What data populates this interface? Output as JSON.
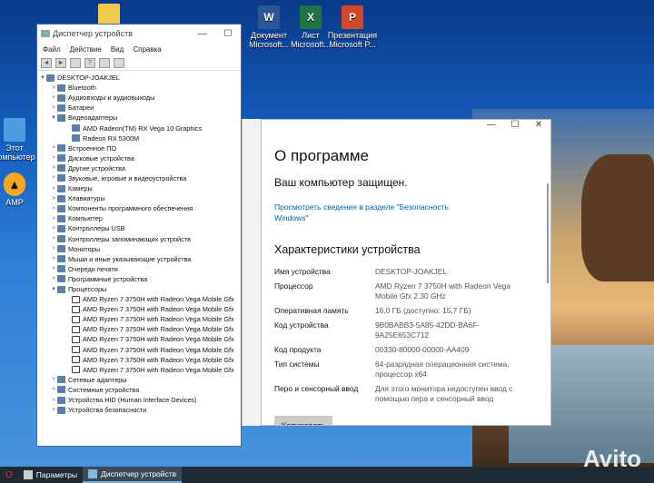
{
  "desktop": {
    "icons": [
      {
        "label": "Документ Microsoft...",
        "icon": "word-icon",
        "color": "#2b5797"
      },
      {
        "label": "Лист Microsoft...",
        "icon": "excel-icon",
        "color": "#217346"
      },
      {
        "label": "Презентация Microsoft P...",
        "icon": "powerpoint-icon",
        "color": "#d24726"
      },
      {
        "label": "Этот компьютер",
        "icon": "this-pc-icon",
        "color": "#4a9de0"
      },
      {
        "label": "AMP",
        "icon": "amd-icon",
        "color": "#111111"
      }
    ]
  },
  "device_manager": {
    "title": "Диспетчер устройств",
    "menu": [
      "Файл",
      "Действие",
      "Вид",
      "Справка"
    ],
    "tree": [
      {
        "label": "DESKTOP-JOAKJEL",
        "level": 0,
        "expander": "▼"
      },
      {
        "label": "Bluetooth",
        "level": 1,
        "expander": ">"
      },
      {
        "label": "Аудиовходы и аудиовыходы",
        "level": 1,
        "expander": ">"
      },
      {
        "label": "Батареи",
        "level": 1,
        "expander": ">"
      },
      {
        "label": "Видеоадаптеры",
        "level": 1,
        "expander": "▼"
      },
      {
        "label": "AMD Radeon(TM) RX Vega 10 Graphics",
        "level": 2,
        "expander": ""
      },
      {
        "label": "Radeon RX 5300M",
        "level": 2,
        "expander": ""
      },
      {
        "label": "Встроенное ПО",
        "level": 1,
        "expander": ">"
      },
      {
        "label": "Дисковые устройства",
        "level": 1,
        "expander": ">"
      },
      {
        "label": "Другие устройства",
        "level": 1,
        "expander": ">"
      },
      {
        "label": "Звуковые, игровые и видеоустройства",
        "level": 1,
        "expander": ">"
      },
      {
        "label": "Камеры",
        "level": 1,
        "expander": ">"
      },
      {
        "label": "Клавиатуры",
        "level": 1,
        "expander": ">"
      },
      {
        "label": "Компоненты программного обеспечения",
        "level": 1,
        "expander": ">"
      },
      {
        "label": "Компьютер",
        "level": 1,
        "expander": ">"
      },
      {
        "label": "Контроллеры USB",
        "level": 1,
        "expander": ">"
      },
      {
        "label": "Контроллеры запоминающих устройств",
        "level": 1,
        "expander": ">"
      },
      {
        "label": "Мониторы",
        "level": 1,
        "expander": ">"
      },
      {
        "label": "Мыши и иные указывающие устройства",
        "level": 1,
        "expander": ">"
      },
      {
        "label": "Очереди печати",
        "level": 1,
        "expander": ">"
      },
      {
        "label": "Программные устройства",
        "level": 1,
        "expander": ">"
      },
      {
        "label": "Процессоры",
        "level": 1,
        "expander": "▼"
      },
      {
        "label": "AMD Ryzen 7 3750H with Radeon Vega Mobile Gfx",
        "level": 2,
        "expander": "",
        "cpu": true
      },
      {
        "label": "AMD Ryzen 7 3750H with Radeon Vega Mobile Gfx",
        "level": 2,
        "expander": "",
        "cpu": true
      },
      {
        "label": "AMD Ryzen 7 3750H with Radeon Vega Mobile Gfx",
        "level": 2,
        "expander": "",
        "cpu": true
      },
      {
        "label": "AMD Ryzen 7 3750H with Radeon Vega Mobile Gfx",
        "level": 2,
        "expander": "",
        "cpu": true
      },
      {
        "label": "AMD Ryzen 7 3750H with Radeon Vega Mobile Gfx",
        "level": 2,
        "expander": "",
        "cpu": true
      },
      {
        "label": "AMD Ryzen 7 3750H with Radeon Vega Mobile Gfx",
        "level": 2,
        "expander": "",
        "cpu": true
      },
      {
        "label": "AMD Ryzen 7 3750H with Radeon Vega Mobile Gfx",
        "level": 2,
        "expander": "",
        "cpu": true
      },
      {
        "label": "AMD Ryzen 7 3750H with Radeon Vega Mobile Gfx",
        "level": 2,
        "expander": "",
        "cpu": true
      },
      {
        "label": "Сетевые адаптеры",
        "level": 1,
        "expander": ">"
      },
      {
        "label": "Системные устройства",
        "level": 1,
        "expander": ">"
      },
      {
        "label": "Устройства HID (Human Interface Devices)",
        "level": 1,
        "expander": ">"
      },
      {
        "label": "Устройства безопасности",
        "level": 1,
        "expander": ">"
      }
    ]
  },
  "about": {
    "title": "О программе",
    "protected": "Ваш компьютер защищен.",
    "link": "Просмотреть сведения в разделе \"Безопасность Windows\"",
    "section_title": "Характеристики устройства",
    "specs": [
      {
        "key": "Имя устройства",
        "value": "DESKTOP-JOAKJEL"
      },
      {
        "key": "Процессор",
        "value": "AMD Ryzen 7 3750H with Radeon Vega Mobile Gfx    2.30 GHz"
      },
      {
        "key": "Оперативная память",
        "value": "16,0 ГБ (доступно: 15,7 ГБ)"
      },
      {
        "key": "Код устройства",
        "value": "9B0BABB3-5A85-42DD-BA6F-9A25E653C712"
      },
      {
        "key": "Код продукта",
        "value": "00330-80000-00000-AA409"
      },
      {
        "key": "Тип системы",
        "value": "64-разрядная операционная система, процессор x64"
      },
      {
        "key": "Перо и сенсорный ввод",
        "value": "Для этого монитора недоступен ввод с помощью пера и сенсорный ввод"
      }
    ],
    "copy_label": "Копировать"
  },
  "taskbar": {
    "items": [
      {
        "label": "Параметры",
        "active": false
      },
      {
        "label": "Диспетчер устройств",
        "active": true
      }
    ]
  },
  "watermark": "Avito"
}
